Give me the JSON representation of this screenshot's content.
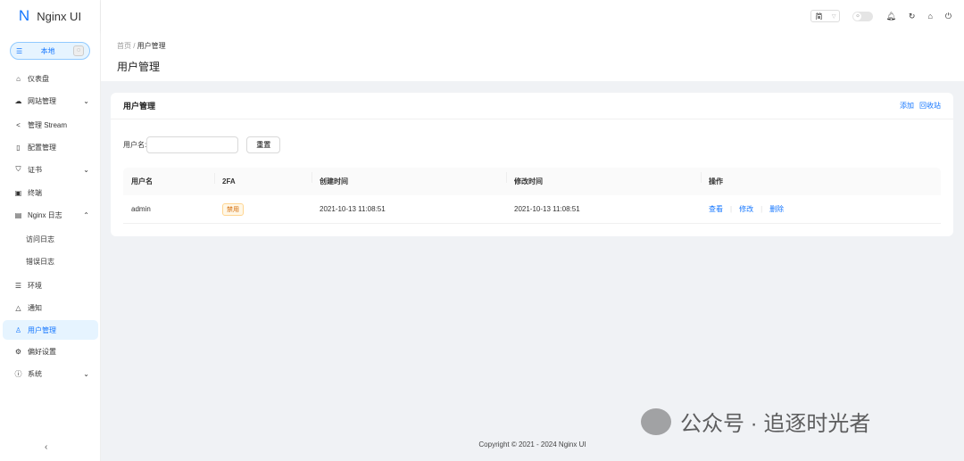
{
  "app": {
    "name": "Nginx UI",
    "env_label": "本地"
  },
  "sidebar": {
    "items": [
      {
        "label": "仪表盘",
        "icon": "home-icon"
      },
      {
        "label": "网站管理",
        "icon": "cloud-icon",
        "arrow": "⌄"
      },
      {
        "label": "管理 Stream",
        "icon": "share-icon"
      },
      {
        "label": "配置管理",
        "icon": "file-icon"
      },
      {
        "label": "证书",
        "icon": "shield-icon",
        "arrow": "⌄"
      },
      {
        "label": "终端",
        "icon": "terminal-icon"
      },
      {
        "label": "Nginx 日志",
        "icon": "file-text-icon",
        "arrow": "⌃"
      },
      {
        "label": "访问日志",
        "sub": true
      },
      {
        "label": "错误日志",
        "sub": true
      },
      {
        "label": "环境",
        "icon": "database-icon"
      },
      {
        "label": "通知",
        "icon": "bell-icon"
      },
      {
        "label": "用户管理",
        "icon": "user-icon",
        "active": true
      },
      {
        "label": "偏好设置",
        "icon": "gear-icon"
      },
      {
        "label": "系统",
        "icon": "info-icon",
        "arrow": "⌄"
      }
    ]
  },
  "header": {
    "language": "简"
  },
  "breadcrumb": {
    "home": "首页",
    "current": "用户管理"
  },
  "page_title": "用户管理",
  "card": {
    "title": "用户管理",
    "add": "添加",
    "trash": "回收站",
    "filter_label": "用户名:",
    "filter_value": "",
    "reset": "重置",
    "columns": [
      "用户名",
      "2FA",
      "创建时间",
      "修改时间",
      "操作"
    ],
    "rows": [
      {
        "username": "admin",
        "twofa": "禁用",
        "created": "2021-10-13 11:08:51",
        "updated": "2021-10-13 11:08:51",
        "actions": [
          "查看",
          "修改",
          "删除"
        ]
      }
    ]
  },
  "footer": "Copyright © 2021 - 2024 Nginx UI",
  "watermark": "公众号 · 追逐时光者"
}
